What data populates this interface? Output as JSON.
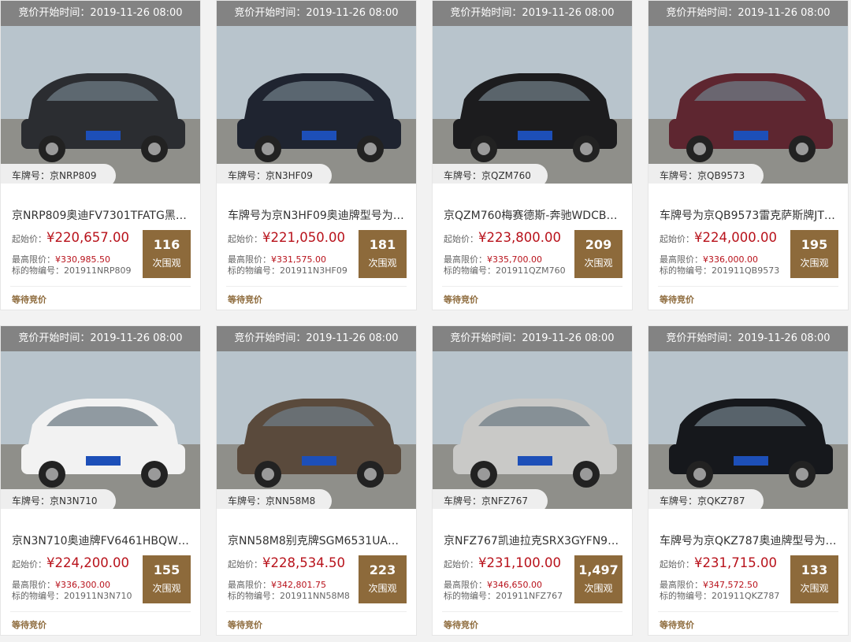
{
  "colors": {
    "accent": "#8d6a3b",
    "price": "#b8121b",
    "time_bar": "#696969"
  },
  "labels": {
    "plate_prefix": "车牌号：",
    "start_price": "起始价：",
    "max_price": "最高限价：",
    "target_id": "标的物编号：",
    "views_unit": "次围观",
    "status": "等待竞价"
  },
  "cards": [
    {
      "time": "竞价开始时间：2019-11-26 08:00",
      "plate": "京NRP809",
      "title": "京NRP809奥迪FV7301TFATG黑…",
      "start_price": "¥220,657.00",
      "max_price": "¥330,985.50",
      "target_id": "201911NRP809",
      "views": "116",
      "car_color": "#2b2d31"
    },
    {
      "time": "竞价开始时间：2019-11-26 08:00",
      "plate": "京N3HF09",
      "title": "车牌号为京N3HF09奥迪牌型号为…",
      "start_price": "¥221,050.00",
      "max_price": "¥331,575.00",
      "target_id": "201911N3HF09",
      "views": "181",
      "car_color": "#1f2430"
    },
    {
      "time": "竞价开始时间：2019-11-26 08:00",
      "plate": "京QZM760",
      "title": "京QZM760梅赛德斯-奔驰WDCB…",
      "start_price": "¥223,800.00",
      "max_price": "¥335,700.00",
      "target_id": "201911QZM760",
      "views": "209",
      "car_color": "#1c1c1e"
    },
    {
      "time": "竞价开始时间：2019-11-26 08:00",
      "plate": "京QB9573",
      "title": "车牌号为京QB9573雷克萨斯牌JT…",
      "start_price": "¥224,000.00",
      "max_price": "¥336,000.00",
      "target_id": "201911QB9573",
      "views": "195",
      "car_color": "#5e2630"
    },
    {
      "time": "竞价开始时间：2019-11-26 08:00",
      "plate": "京N3N710",
      "title": "京N3N710奥迪牌FV6461HBQW…",
      "start_price": "¥224,200.00",
      "max_price": "¥336,300.00",
      "target_id": "201911N3N710",
      "views": "155",
      "car_color": "#f2f2f2"
    },
    {
      "time": "竞价开始时间：2019-11-26 08:00",
      "plate": "京NN58M8",
      "title": "京NN58M8别克牌SGM6531UA…",
      "start_price": "¥228,534.50",
      "max_price": "¥342,801.75",
      "target_id": "201911NN58M8",
      "views": "223",
      "car_color": "#5a4a3c"
    },
    {
      "time": "竞价开始时间：2019-11-26 08:00",
      "plate": "京NFZ767",
      "title": "京NFZ767凯迪拉克SRX3GYFN9…",
      "start_price": "¥231,100.00",
      "max_price": "¥346,650.00",
      "target_id": "201911NFZ767",
      "views": "1,497",
      "car_color": "#c9c9c7"
    },
    {
      "time": "竞价开始时间：2019-11-26 08:00",
      "plate": "京QKZ787",
      "title": "车牌号为京QKZ787奥迪牌型号为…",
      "start_price": "¥231,715.00",
      "max_price": "¥347,572.50",
      "target_id": "201911QKZ787",
      "views": "133",
      "car_color": "#16181c"
    }
  ]
}
